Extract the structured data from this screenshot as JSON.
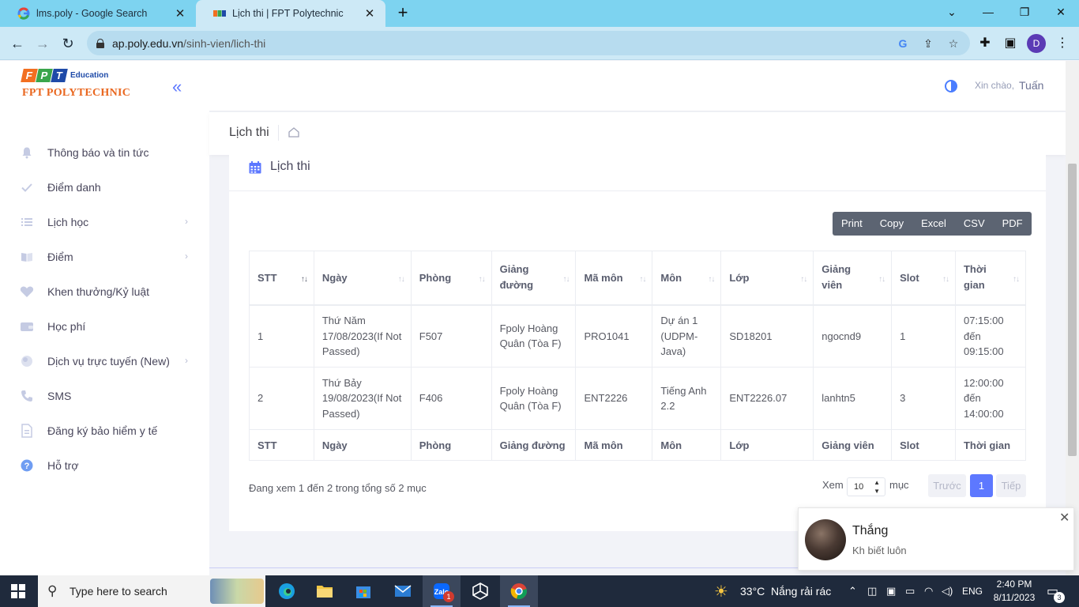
{
  "browser": {
    "tabs": [
      {
        "title": "lms.poly - Google Search",
        "favicon": "google-icon"
      },
      {
        "title": "Lịch thi | FPT Polytechnic",
        "favicon": "fpt-icon"
      }
    ],
    "new_tab": "+",
    "url_host": "ap.poly.edu.vn",
    "url_path": "/sinh-vien/lich-thi",
    "profile_initial": "D"
  },
  "logo": {
    "letters": [
      "F",
      "P",
      "T"
    ],
    "edu": "Education",
    "name": "FPT POLYTECHNIC"
  },
  "sidebar": {
    "items": [
      {
        "label": "Thông báo và tin tức",
        "icon": "bell-icon",
        "has_arrow": false
      },
      {
        "label": "Điểm danh",
        "icon": "check-icon",
        "has_arrow": false
      },
      {
        "label": "Lịch học",
        "icon": "list-icon",
        "has_arrow": true
      },
      {
        "label": "Điểm",
        "icon": "book-icon",
        "has_arrow": true
      },
      {
        "label": "Khen thưởng/Kỷ luật",
        "icon": "heart-icon",
        "has_arrow": false
      },
      {
        "label": "Học phí",
        "icon": "wallet-icon",
        "has_arrow": false
      },
      {
        "label": "Dịch vụ trực tuyến (New)",
        "icon": "globe-icon",
        "has_arrow": true
      },
      {
        "label": "SMS",
        "icon": "phone-icon",
        "has_arrow": false
      },
      {
        "label": "Đăng ký bảo hiểm y tế",
        "icon": "document-icon",
        "has_arrow": false
      },
      {
        "label": "Hỗ trợ",
        "icon": "help-icon",
        "has_arrow": false
      }
    ]
  },
  "header": {
    "greeting": "Xin chào,",
    "user_name": "Tuấn"
  },
  "subheader": {
    "title": "Lịch thi"
  },
  "card": {
    "title": "Lịch thi",
    "export_buttons": [
      "Print",
      "Copy",
      "Excel",
      "CSV",
      "PDF"
    ]
  },
  "table": {
    "columns": [
      "STT",
      "Ngày",
      "Phòng",
      "Giảng đường",
      "Mã môn",
      "Môn",
      "Lớp",
      "Giảng viên",
      "Slot",
      "Thời gian"
    ],
    "rows": [
      [
        "1",
        "Thứ Năm 17/08/2023(If Not Passed)",
        "F507",
        "Fpoly Hoàng Quân (Tòa F)",
        "PRO1041",
        "Dự án 1 (UDPM-Java)",
        "SD18201",
        "ngocnd9",
        "1",
        "07:15:00 đến 09:15:00"
      ],
      [
        "2",
        "Thứ Bảy 19/08/2023(If Not Passed)",
        "F406",
        "Fpoly Hoàng Quân (Tòa F)",
        "ENT2226",
        "Tiếng Anh 2.2",
        "ENT2226.07",
        "lanhtn5",
        "3",
        "12:00:00 đến 14:00:00"
      ]
    ]
  },
  "pagination": {
    "info": "Đang xem 1 đến 2 trong tổng số 2 mục",
    "length_label": "Xem",
    "length_value": "10",
    "length_suffix": "mục",
    "prev": "Trước",
    "current": "1",
    "next": "Tiếp"
  },
  "toast": {
    "sender": "Thắng",
    "message": "Kh biết luôn"
  },
  "taskbar": {
    "search_placeholder": "Type here to search",
    "weather_temp": "33°C",
    "weather_desc": "Nắng rải rác",
    "language": "ENG",
    "time": "2:40 PM",
    "date": "8/11/2023",
    "notifications": "3",
    "zalo_badge": "1"
  },
  "colors": {
    "accent": "#5d78ff",
    "tab_bar": "#7dd3f0",
    "logo_orange": "#e9661e",
    "logo_blue": "#1e4aa8",
    "logo_green": "#3aa54b",
    "export_bg": "#5c6472"
  }
}
